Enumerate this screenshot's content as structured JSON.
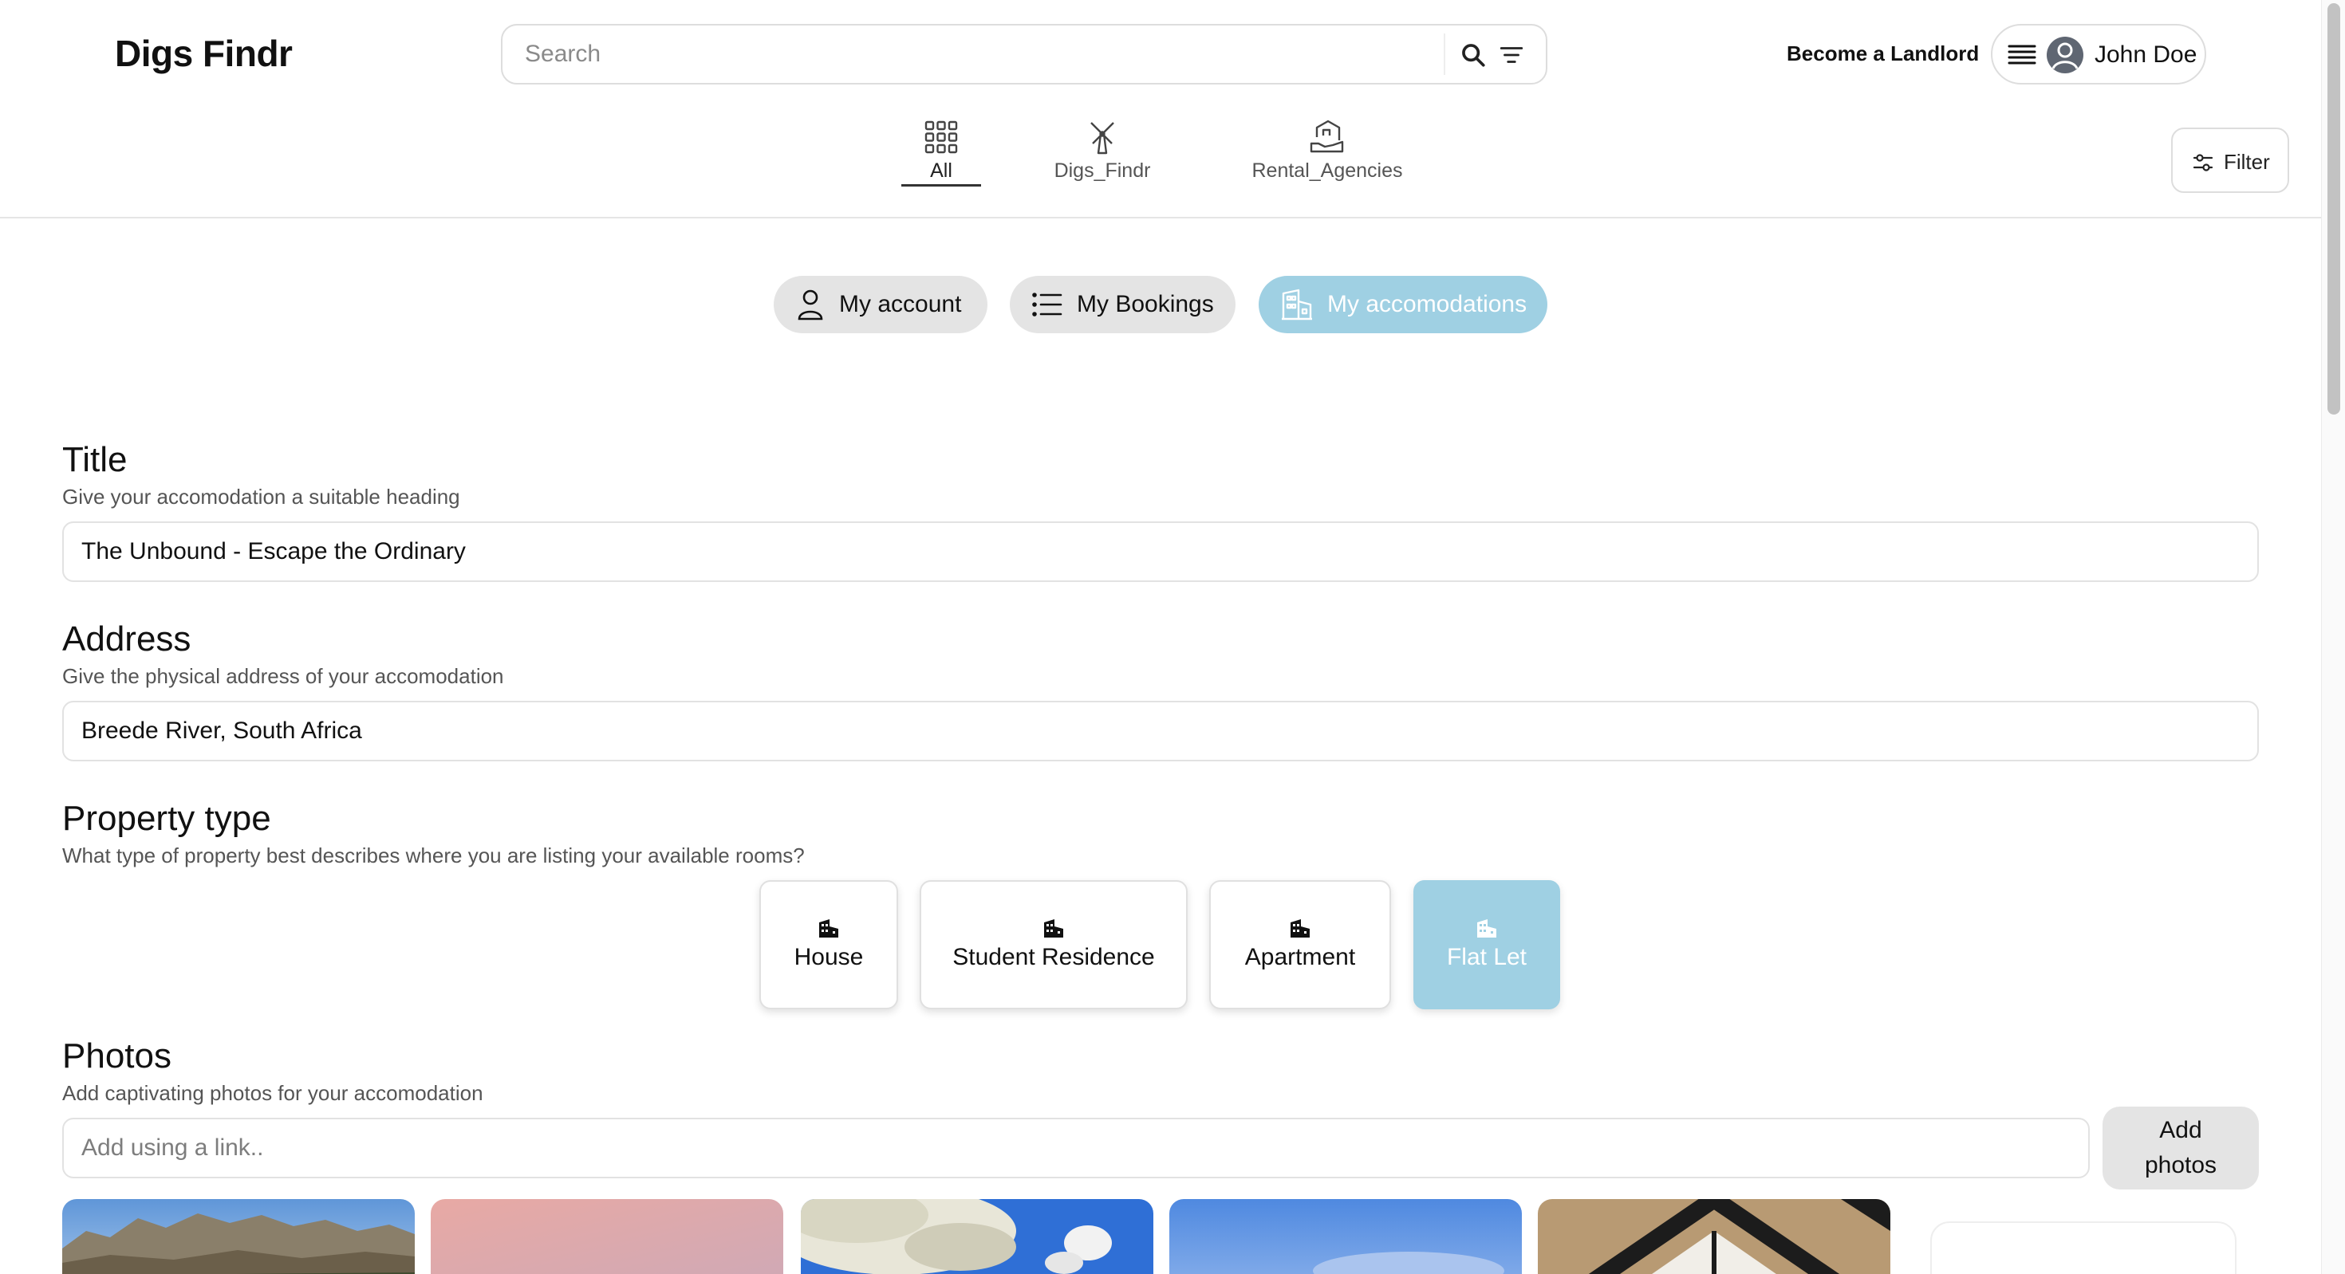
{
  "header": {
    "logo": "Digs Findr",
    "search_placeholder": "Search",
    "become_landlord": "Become a Landlord",
    "user_name": "John Doe",
    "filter_label": "Filter"
  },
  "categories": [
    {
      "label": "All",
      "icon": "grid-icon",
      "active": true
    },
    {
      "label": "Digs_Findr",
      "icon": "windmill-icon",
      "active": false
    },
    {
      "label": "Rental_Agencies",
      "icon": "house-hand-icon",
      "active": false
    }
  ],
  "account_tabs": [
    {
      "label": "My account",
      "icon": "user-icon",
      "active": false
    },
    {
      "label": "My Bookings",
      "icon": "list-icon",
      "active": false
    },
    {
      "label": "My accomodations",
      "icon": "building-icon",
      "active": true
    }
  ],
  "form": {
    "title": {
      "heading": "Title",
      "subheading": "Give your accomodation a suitable heading",
      "value": "The Unbound - Escape the Ordinary"
    },
    "address": {
      "heading": "Address",
      "subheading": "Give the physical address of your accomodation",
      "value": "Breede River, South Africa"
    },
    "property_type": {
      "heading": "Property type",
      "subheading": "What type of property best describes where you are listing your available rooms?",
      "options": [
        {
          "label": "House",
          "icon": "building-icon",
          "selected": false
        },
        {
          "label": "Student Residence",
          "icon": "building-icon",
          "selected": false
        },
        {
          "label": "Apartment",
          "icon": "building-icon",
          "selected": false
        },
        {
          "label": "Flat Let",
          "icon": "building-icon",
          "selected": true
        }
      ]
    },
    "photos": {
      "heading": "Photos",
      "subheading": "Add captivating photos for your accomodation",
      "link_placeholder": "Add using a link..",
      "add_button": "Add photos"
    }
  },
  "colors": {
    "accent": "#9fd0e3",
    "pill_inactive": "#e4e4e4",
    "border": "#dddddd"
  }
}
